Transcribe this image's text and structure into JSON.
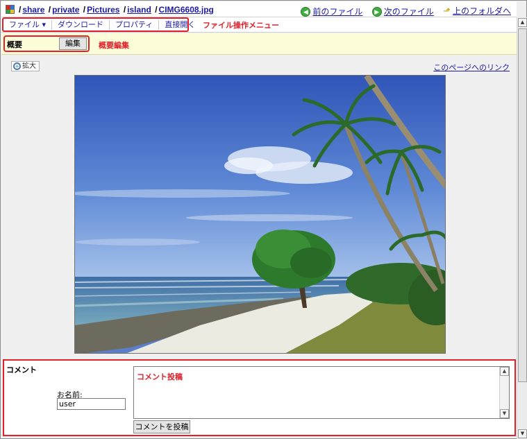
{
  "breadcrumb": {
    "icon": "folder-color-icon",
    "items": [
      "share",
      "private",
      "Pictures",
      "island",
      "CIMG6608.jpg"
    ]
  },
  "nav": {
    "prev": "前のファイル",
    "next": "次のファイル",
    "up": "上のフォルダへ"
  },
  "menu": {
    "items": [
      "ファイル ▾",
      "ダウンロード",
      "プロパティ",
      "直接開く"
    ],
    "annotation": "ファイル操作メニュー"
  },
  "summary": {
    "label": "概要",
    "edit_button": "編集",
    "annotation": "概要編集"
  },
  "viewer": {
    "zoom_label": "拡大",
    "page_link": "このページへのリンク"
  },
  "comment": {
    "title": "コメント",
    "name_label": "お名前:",
    "name_value": "user",
    "textarea_annotation": "コメント投稿",
    "submit": "コメントを投稿"
  },
  "colors": {
    "annotation_red": "#e0202a",
    "link_blue": "#1a1aa6",
    "summary_bg": "#fcfcd8"
  }
}
